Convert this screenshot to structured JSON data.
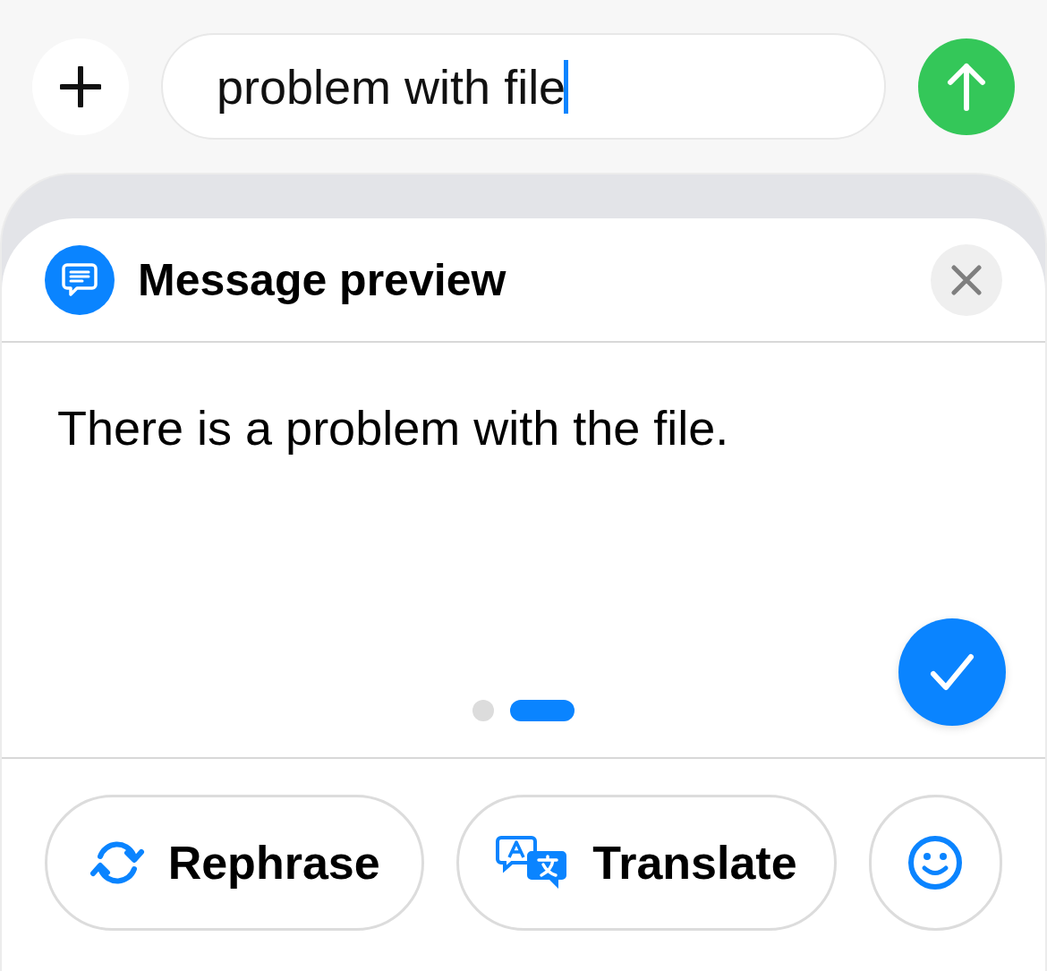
{
  "composer": {
    "value": "problem with file"
  },
  "preview": {
    "title": "Message preview",
    "message": "There is a problem with the file.",
    "pages": [
      {
        "selected": false
      },
      {
        "selected": true
      }
    ]
  },
  "actions": [
    {
      "kind": "rephrase",
      "label": "Rephrase"
    },
    {
      "kind": "translate",
      "label": "Translate"
    },
    {
      "kind": "emoji"
    }
  ]
}
